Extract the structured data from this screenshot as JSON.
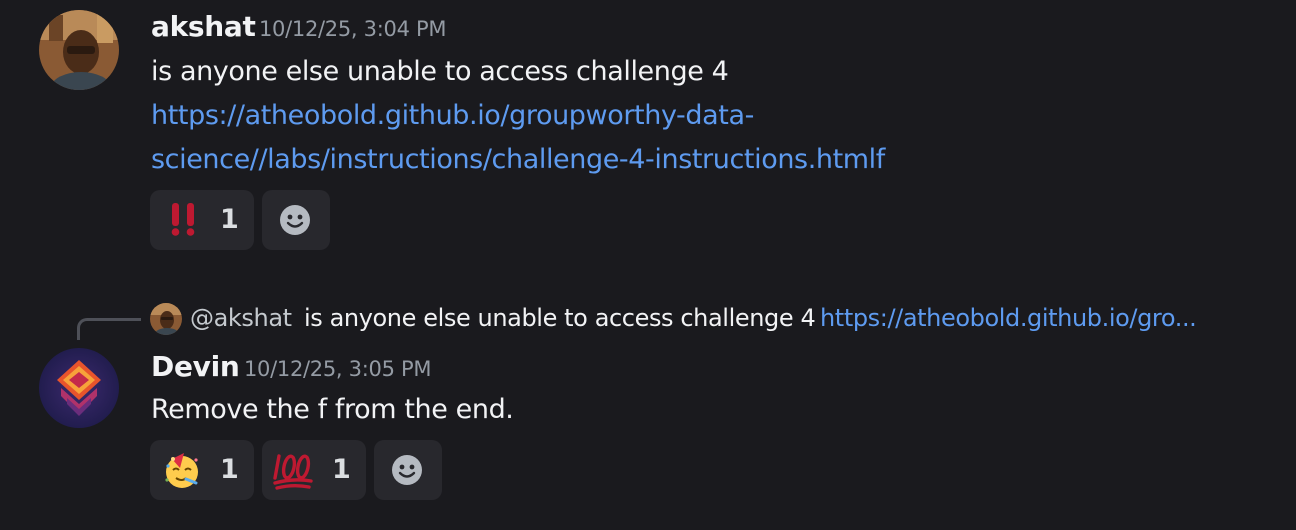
{
  "messages": [
    {
      "author": "akshat",
      "timestamp": "10/12/25, 3:04 PM",
      "text": "is anyone else unable to access challenge 4",
      "link_line1": "https://atheobold.github.io/groupworthy-data-",
      "link_line2": "science//labs/instructions/challenge-4-instructions.htmlf",
      "reactions": [
        {
          "emoji": "bangbang-icon",
          "count": "1"
        }
      ]
    },
    {
      "author": "Devin",
      "timestamp": "10/12/25, 3:05 PM",
      "text": "Remove the f from the end.",
      "reply": {
        "mention": "@akshat",
        "text": "is anyone else unable to access challenge 4",
        "link": "https://atheobold.github.io/gro..."
      },
      "reactions": [
        {
          "emoji": "partying-face-icon",
          "count": "1"
        },
        {
          "emoji": "hundred-points-icon",
          "count": "1"
        }
      ]
    }
  ],
  "colors": {
    "background": "#1a1a1e",
    "link": "#5e9bf0",
    "reaction_bg": "#28282d",
    "timestamp": "#949ba4"
  }
}
